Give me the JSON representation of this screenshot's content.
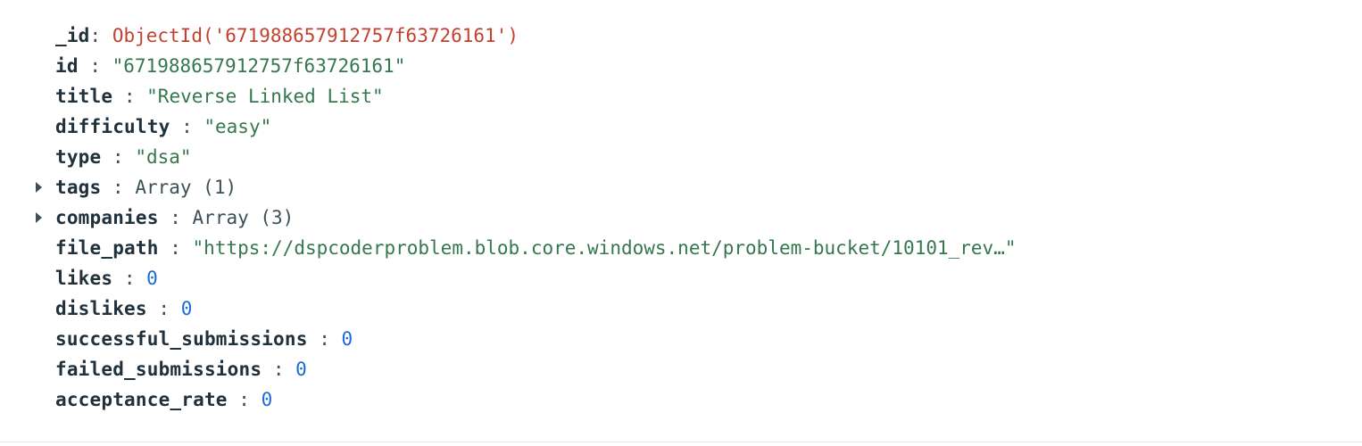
{
  "document": {
    "fields": [
      {
        "key": "_id",
        "sep": ": ",
        "value": "ObjectId('671988657912757f63726161')"
      },
      {
        "key": "id",
        "sep": " : ",
        "value": "\"671988657912757f63726161\""
      },
      {
        "key": "title",
        "sep": " : ",
        "value": "\"Reverse Linked List\""
      },
      {
        "key": "difficulty",
        "sep": " : ",
        "value": "\"easy\""
      },
      {
        "key": "type",
        "sep": " : ",
        "value": "\"dsa\""
      },
      {
        "key": "tags",
        "sep": " : ",
        "value": "Array (1)"
      },
      {
        "key": "companies",
        "sep": " : ",
        "value": "Array (3)"
      },
      {
        "key": "file_path",
        "sep": " : ",
        "value": "\"https://dspcoderproblem.blob.core.windows.net/problem-bucket/10101_rev…\""
      },
      {
        "key": "likes",
        "sep": " : ",
        "value": "0"
      },
      {
        "key": "dislikes",
        "sep": " : ",
        "value": "0"
      },
      {
        "key": "successful_submissions",
        "sep": " : ",
        "value": "0"
      },
      {
        "key": "failed_submissions",
        "sep": " : ",
        "value": "0"
      },
      {
        "key": "acceptance_rate",
        "sep": " : ",
        "value": "0"
      }
    ]
  },
  "icons": {
    "expand": "caret-right-icon"
  },
  "colors": {
    "key": "#21313c",
    "string": "#35774e",
    "objectid": "#c2412f",
    "number": "#1a6bd8",
    "text": "#3d4f58"
  }
}
